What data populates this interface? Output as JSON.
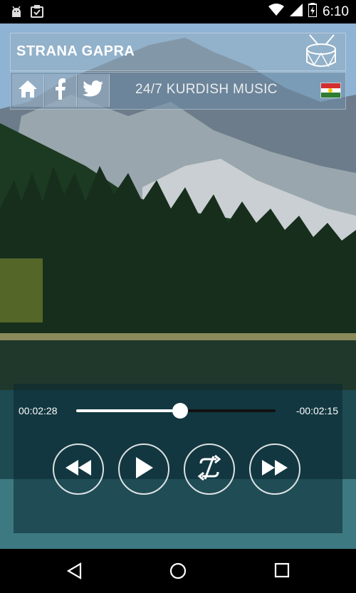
{
  "status_bar": {
    "time": "6:10",
    "icons": [
      "android-debug-icon",
      "clipboard-check-icon",
      "wifi-icon",
      "battery-icon"
    ]
  },
  "header": {
    "title": "STRANA GAPRA",
    "logo": "drum-icon",
    "tagline": "24/7 KURDISH MUSIC",
    "buttons": [
      "home-icon",
      "facebook-icon",
      "twitter-icon"
    ],
    "flag": "kurdistan-flag-icon"
  },
  "player": {
    "elapsed": "00:02:28",
    "remaining": "-00:02:15",
    "progress": 0.52,
    "controls": [
      "rewind-icon",
      "play-icon",
      "repeat-icon",
      "fast-forward-icon"
    ]
  },
  "nav_bar": {
    "buttons": [
      "back-icon",
      "home-nav-icon",
      "recents-icon"
    ]
  },
  "colors": {
    "flag_top": "#d32f2f",
    "flag_middle": "#ffffff",
    "flag_bottom": "#2e7d32",
    "flag_sun": "#f5c400"
  }
}
